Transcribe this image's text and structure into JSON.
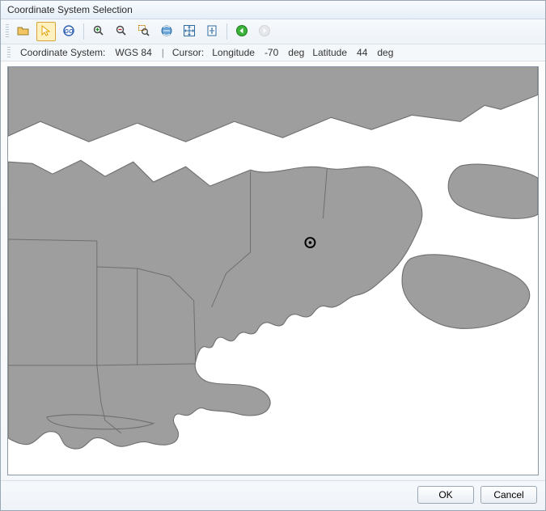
{
  "window": {
    "title": "Coordinate System Selection"
  },
  "toolbar": {
    "items": [
      {
        "name": "open-folder-icon"
      },
      {
        "name": "arrow-cursor-icon"
      },
      {
        "name": "go-icon"
      },
      {
        "name": "zoom-in-icon"
      },
      {
        "name": "zoom-out-icon"
      },
      {
        "name": "zoom-window-icon"
      },
      {
        "name": "pan-icon"
      },
      {
        "name": "fit-all-icon"
      },
      {
        "name": "fit-page-icon"
      },
      {
        "name": "back-icon"
      },
      {
        "name": "forward-icon"
      }
    ]
  },
  "status": {
    "coord_system_label": "Coordinate System:",
    "coord_system_value": "WGS 84",
    "cursor_label": "Cursor:",
    "lon_label": "Longitude",
    "lon_value": "-70",
    "lon_unit": "deg",
    "lat_label": "Latitude",
    "lat_value": "44",
    "lat_unit": "deg"
  },
  "map": {
    "marker": {
      "longitude": -70,
      "latitude": 44
    },
    "region_description": "Northeast USA / Atlantic Canada coastline"
  },
  "footer": {
    "ok_label": "OK",
    "cancel_label": "Cancel"
  },
  "colors": {
    "land": "#9e9e9e",
    "land_stroke": "#6f6f6f",
    "water": "#ffffff"
  }
}
